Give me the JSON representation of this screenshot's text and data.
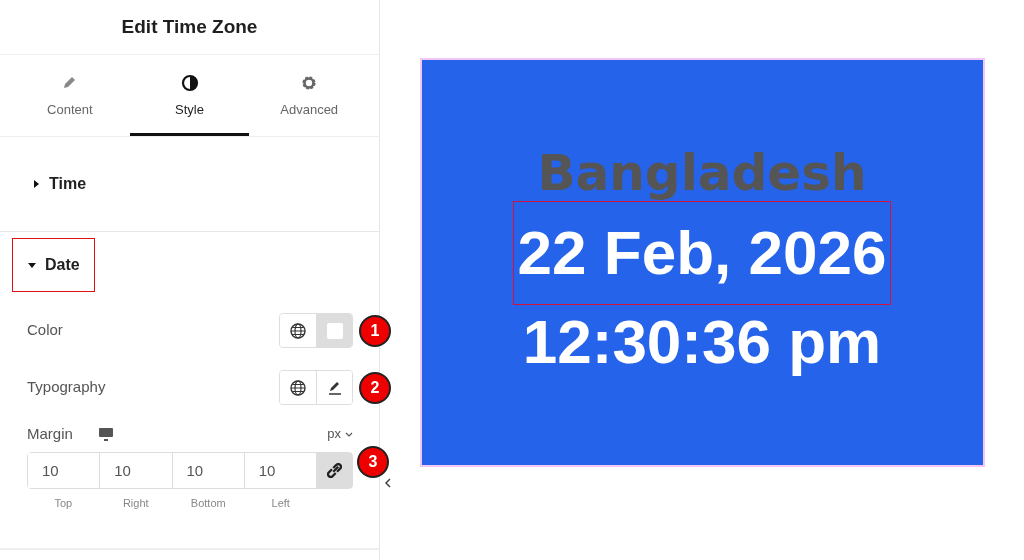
{
  "panel": {
    "title": "Edit Time Zone"
  },
  "tabs": [
    {
      "label": "Content",
      "kind": "pencil",
      "selected": false
    },
    {
      "label": "Style",
      "kind": "contrast",
      "selected": true
    },
    {
      "label": "Advanced",
      "kind": "gear",
      "selected": false
    }
  ],
  "sections": [
    {
      "title": "Time",
      "expanded": false,
      "highlighted": false
    },
    {
      "title": "Date",
      "expanded": true,
      "highlighted": true
    }
  ],
  "controls": [
    {
      "kind": "color",
      "label": "Color",
      "callout": "1"
    },
    {
      "kind": "typography",
      "label": "Typography",
      "callout": "2"
    }
  ],
  "margin": {
    "label": "Margin",
    "unit": "px",
    "linked": true,
    "callout": "3",
    "fields": [
      {
        "value": "10",
        "label": "Top"
      },
      {
        "value": "10",
        "label": "Right"
      },
      {
        "value": "10",
        "label": "Bottom"
      },
      {
        "value": "10",
        "label": "Left"
      }
    ]
  },
  "preview": {
    "country": "Bangladesh",
    "date": "22 Feb, 2026",
    "time": "12:30:36 pm",
    "date_highlighted": true
  }
}
